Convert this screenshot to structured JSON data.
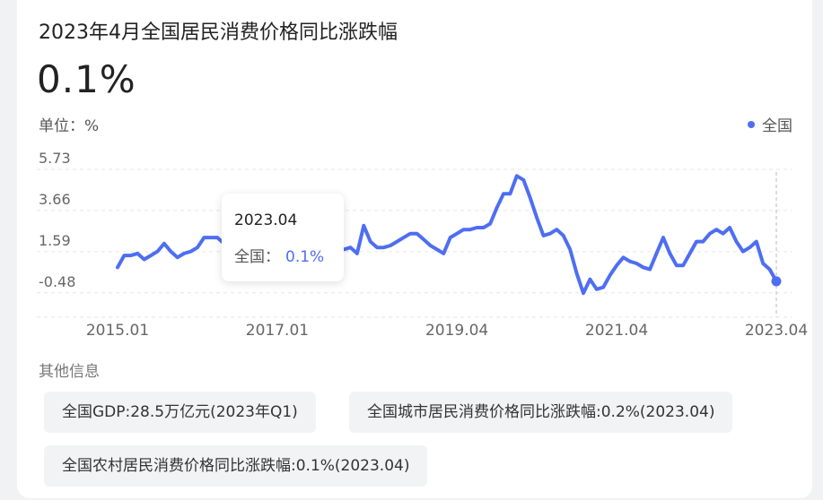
{
  "title": "2023年4月全国居民消费价格同比涨跌幅",
  "current_value": "0.1%",
  "unit_label": "单位：%",
  "legend": {
    "label": "全国",
    "color": "#4e6ef2"
  },
  "tooltip": {
    "date": "2023.04",
    "series_label": "全国：",
    "value": "0.1%"
  },
  "other_info": {
    "heading": "其他信息",
    "items": [
      "全国GDP:28.5万亿元(2023年Q1)",
      "全国城市居民消费价格同比涨跌幅:0.2%(2023.04)",
      "全国农村居民消费价格同比涨跌幅:0.1%(2023.04)"
    ]
  },
  "chart_data": {
    "type": "line",
    "y_ticks": [
      "5.73",
      "3.66",
      "1.59",
      "-0.48"
    ],
    "x_ticks": [
      "2015.01",
      "2017.01",
      "2019.04",
      "2021.04",
      "2023.04"
    ],
    "ylim": [
      -1.3,
      5.73
    ],
    "grid": true,
    "legend_position": "top-right",
    "series": [
      {
        "name": "全国",
        "color": "#4e6ef2",
        "x": [
          "2015.01",
          "2015.02",
          "2015.03",
          "2015.04",
          "2015.05",
          "2015.06",
          "2015.07",
          "2015.08",
          "2015.09",
          "2015.10",
          "2015.11",
          "2015.12",
          "2016.01",
          "2016.02",
          "2016.03",
          "2016.04",
          "2016.05",
          "2016.06",
          "2016.07",
          "2016.08",
          "2016.09",
          "2016.10",
          "2016.11",
          "2016.12",
          "2017.01",
          "2017.02",
          "2017.03",
          "2017.04",
          "2017.05",
          "2017.06",
          "2017.07",
          "2017.08",
          "2017.09",
          "2017.10",
          "2017.11",
          "2017.12",
          "2018.01",
          "2018.02",
          "2018.03",
          "2018.04",
          "2018.05",
          "2018.06",
          "2018.07",
          "2018.08",
          "2018.09",
          "2018.10",
          "2018.11",
          "2018.12",
          "2019.01",
          "2019.02",
          "2019.03",
          "2019.04",
          "2019.05",
          "2019.06",
          "2019.07",
          "2019.08",
          "2019.09",
          "2019.10",
          "2019.11",
          "2019.12",
          "2020.01",
          "2020.02",
          "2020.03",
          "2020.04",
          "2020.05",
          "2020.06",
          "2020.07",
          "2020.08",
          "2020.09",
          "2020.10",
          "2020.11",
          "2020.12",
          "2021.01",
          "2021.02",
          "2021.03",
          "2021.04",
          "2021.05",
          "2021.06",
          "2021.07",
          "2021.08",
          "2021.09",
          "2021.10",
          "2021.11",
          "2021.12",
          "2022.01",
          "2022.02",
          "2022.03",
          "2022.04",
          "2022.05",
          "2022.06",
          "2022.07",
          "2022.08",
          "2022.09",
          "2022.10",
          "2022.11",
          "2022.12",
          "2023.01",
          "2023.02",
          "2023.03",
          "2023.04"
        ],
        "values": [
          0.8,
          1.4,
          1.4,
          1.5,
          1.2,
          1.4,
          1.6,
          2.0,
          1.6,
          1.3,
          1.5,
          1.6,
          1.8,
          2.3,
          2.3,
          2.3,
          2.0,
          1.9,
          1.8,
          1.3,
          1.9,
          2.1,
          2.3,
          2.1,
          2.5,
          0.8,
          0.9,
          1.2,
          1.5,
          1.5,
          1.4,
          1.8,
          1.6,
          1.9,
          1.7,
          1.8,
          1.5,
          2.9,
          2.1,
          1.8,
          1.8,
          1.9,
          2.1,
          2.3,
          2.5,
          2.5,
          2.2,
          1.9,
          1.7,
          1.5,
          2.3,
          2.5,
          2.7,
          2.7,
          2.8,
          2.8,
          3.0,
          3.8,
          4.5,
          4.5,
          5.4,
          5.2,
          4.3,
          3.3,
          2.4,
          2.5,
          2.7,
          2.4,
          1.7,
          0.5,
          -0.5,
          0.2,
          -0.3,
          -0.2,
          0.4,
          0.9,
          1.3,
          1.1,
          1.0,
          0.8,
          0.7,
          1.5,
          2.3,
          1.5,
          0.9,
          0.9,
          1.5,
          2.1,
          2.1,
          2.5,
          2.7,
          2.5,
          2.8,
          2.1,
          1.6,
          1.8,
          2.1,
          1.0,
          0.7,
          0.1
        ]
      }
    ]
  }
}
